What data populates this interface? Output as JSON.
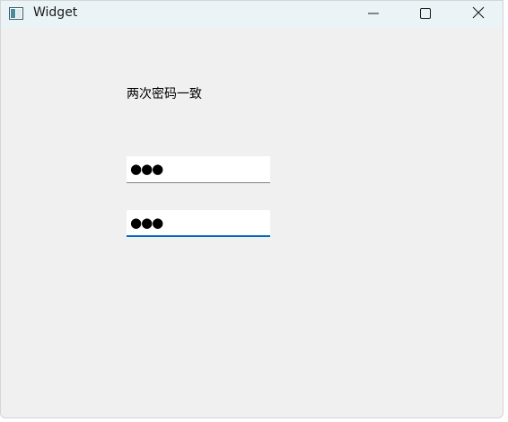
{
  "window": {
    "title": "Widget",
    "icon": "app-window-icon",
    "controls": {
      "minimize_icon": "minimize-icon",
      "maximize_icon": "maximize-icon",
      "close_icon": "close-icon"
    }
  },
  "main": {
    "status_label": "两次密码一致",
    "password_field_1": {
      "masked_value": "●●●"
    },
    "password_field_2": {
      "masked_value": "●●●"
    }
  },
  "colors": {
    "focus_accent": "#0067c0",
    "titlebar_bg": "#eaf3f6",
    "window_bg": "#f0f0f0"
  }
}
